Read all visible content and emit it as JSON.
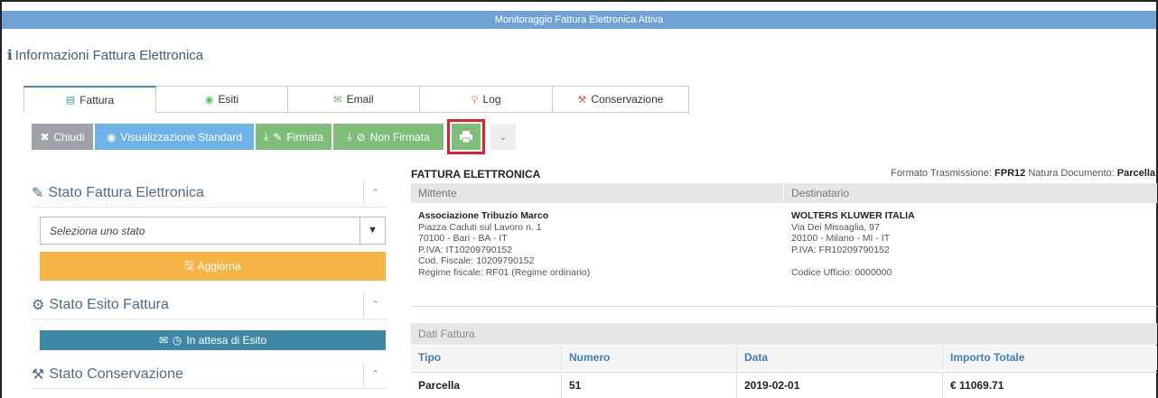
{
  "window": {
    "title": "Monitoraggio Fattura Elettronica Attiva"
  },
  "page": {
    "heading": "Informazioni Fattura Elettronica",
    "heading_icon": "info-icon"
  },
  "tabs": [
    {
      "label": "Fattura",
      "icon": "file-icon",
      "active": true
    },
    {
      "label": "Esiti",
      "icon": "eye-icon",
      "active": false
    },
    {
      "label": "Email",
      "icon": "envelope-icon",
      "active": false
    },
    {
      "label": "Log",
      "icon": "search-icon",
      "active": false
    },
    {
      "label": "Conservazione",
      "icon": "gavel-icon",
      "active": false
    }
  ],
  "toolbar": {
    "close_label": "Chiudi",
    "standard_view_label": "Visualizzazione Standard",
    "signed_label": "Firmata",
    "unsigned_label": "Non Firmata"
  },
  "sidebar": {
    "stato_fattura": {
      "title": "Stato Fattura Elettronica",
      "select_placeholder": "Seleziona uno stato",
      "update_label": "Aggiorna"
    },
    "stato_esito": {
      "title": "Stato Esito Fattura",
      "status_label": "In attesa di Esito"
    },
    "stato_conservazione": {
      "title": "Stato Conservazione"
    }
  },
  "invoice": {
    "title": "FATTURA ELETTRONICA",
    "format_label": "Formato Trasmissione:",
    "format_value": "FPR12",
    "nature_label": "Natura Documento:",
    "nature_value": "Parcella",
    "mittente": {
      "header": "Mittente",
      "name": "Associazione Tribuzio Marco",
      "address": "Piazza Caduti sul Lavoro n. 1",
      "city": "70100 - Bari - BA - IT",
      "piva": "P.IVA: IT10209790152",
      "cf": "Cod. Fiscale: 10209790152",
      "regime": "Regime fiscale: RF01 (Regime ordinario)"
    },
    "destinatario": {
      "header": "Destinatario",
      "name": "WOLTERS KLUWER ITALIA",
      "address": "Via Dei Missaglia, 97",
      "city": "20100 - Milano - MI - IT",
      "piva": "P.IVA: FR10209790152",
      "ufficio": "Codice Ufficio: 0000000"
    },
    "dati": {
      "header": "Dati Fattura",
      "columns": [
        "Tipo",
        "Numero",
        "Data",
        "Importo Totale"
      ],
      "row": [
        "Parcella",
        "51",
        "2019-02-01",
        "€ 11069.71"
      ]
    }
  },
  "colors": {
    "title_bar": "#6fa3d6",
    "accent_blue": "#6db3e8",
    "green": "#7fbe7a",
    "orange": "#f7b446",
    "teal": "#3f87a6",
    "highlight_red": "#e0202a"
  }
}
